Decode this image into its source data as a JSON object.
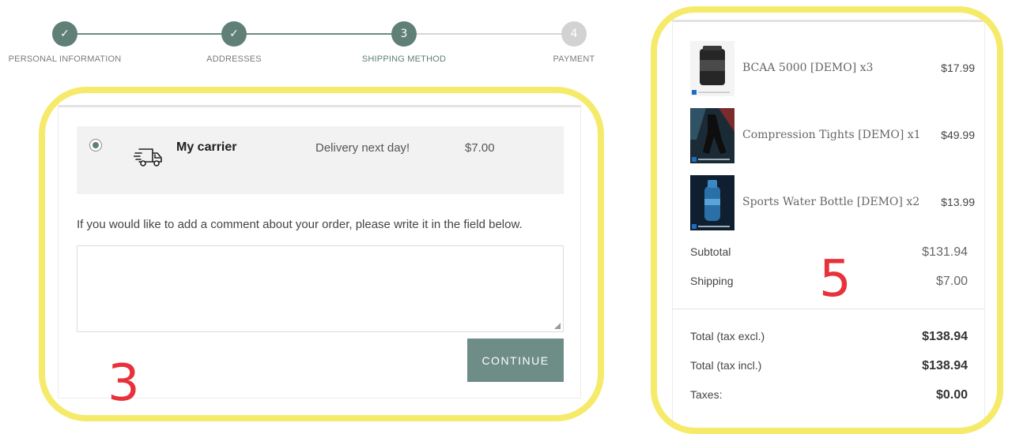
{
  "stepper": {
    "steps": [
      {
        "label": "PERSONAL INFORMATION",
        "state": "done",
        "marker": "✓"
      },
      {
        "label": "ADDRESSES",
        "state": "done",
        "marker": "✓"
      },
      {
        "label": "SHIPPING METHOD",
        "state": "current",
        "marker": "3"
      },
      {
        "label": "PAYMENT",
        "state": "todo",
        "marker": "4"
      }
    ]
  },
  "shipping": {
    "carrier_name": "My carrier",
    "carrier_delay": "Delivery next day!",
    "carrier_price": "$7.00",
    "carrier_icon": "truck-icon",
    "comment_label": "If you would like to add a comment about your order, please write it in the field below.",
    "comment_value": "",
    "continue_label": "CONTINUE"
  },
  "summary": {
    "products": [
      {
        "name": "BCAA 5000 [DEMO] x3",
        "price": "$17.99",
        "thumb_color": "#2a2a2a"
      },
      {
        "name": "Compression Tights [DEMO] x1",
        "price": "$49.99",
        "thumb_color": "#1e3a4a"
      },
      {
        "name": "Sports Water Bottle [DEMO] x2",
        "price": "$13.99",
        "thumb_color": "#1c4e78"
      }
    ],
    "subtotal_label": "Subtotal",
    "subtotal_value": "$131.94",
    "shipping_label": "Shipping",
    "shipping_value": "$7.00",
    "total_excl_label": "Total (tax excl.)",
    "total_excl_value": "$138.94",
    "total_incl_label": "Total (tax incl.)",
    "total_incl_value": "$138.94",
    "taxes_label": "Taxes:",
    "taxes_value": "$0.00"
  },
  "annotations": {
    "left_number": "3",
    "right_number": "5",
    "ring_color": "#f6ea6a",
    "number_color": "#e8313a"
  },
  "colors": {
    "accent": "#5f7f77",
    "button": "#6d8d86"
  }
}
